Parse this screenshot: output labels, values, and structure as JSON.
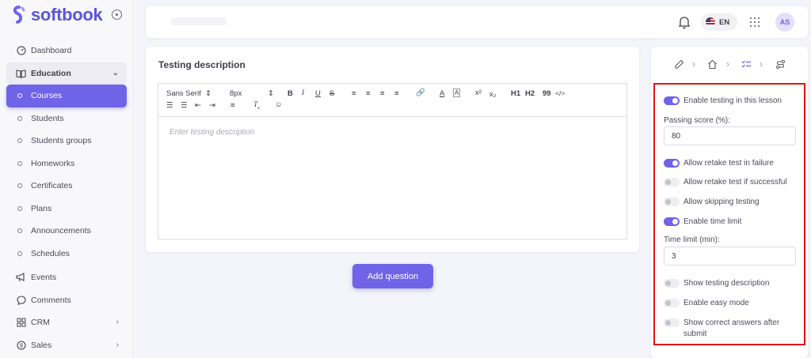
{
  "brand": {
    "name": "softbook",
    "accent": "#6f64e8"
  },
  "sidebar": {
    "items": [
      {
        "label": "Dashboard",
        "icon": "dashboard-icon"
      },
      {
        "label": "Education",
        "icon": "book-icon"
      },
      {
        "label": "Courses"
      },
      {
        "label": "Students"
      },
      {
        "label": "Students groups"
      },
      {
        "label": "Homeworks"
      },
      {
        "label": "Certificates"
      },
      {
        "label": "Plans"
      },
      {
        "label": "Announcements"
      },
      {
        "label": "Schedules"
      },
      {
        "label": "Events",
        "icon": "megaphone-icon"
      },
      {
        "label": "Comments",
        "icon": "comment-icon"
      },
      {
        "label": "CRM",
        "icon": "grid-icon"
      },
      {
        "label": "Sales",
        "icon": "dollar-icon"
      }
    ]
  },
  "header": {
    "language": "EN",
    "avatar": "AS"
  },
  "main": {
    "title": "Testing description",
    "toolbar": {
      "font": "Sans Serif",
      "size": "8px",
      "h1": "H1",
      "h2": "H2",
      "quote": "99",
      "code": "</>"
    },
    "placeholder": "Enter testing description",
    "add_question": "Add question"
  },
  "settings": {
    "enable_testing": {
      "label": "Enable testing in this lesson",
      "on": true
    },
    "passing_score_label": "Passing score (%):",
    "passing_score": "80",
    "retake_failure": {
      "label": "Allow retake test in failure",
      "on": true
    },
    "retake_success": {
      "label": "Allow retake test if successful",
      "on": false
    },
    "skip_testing": {
      "label": "Allow skipping testing",
      "on": false
    },
    "time_limit_toggle": {
      "label": "Enable time limit",
      "on": true
    },
    "time_limit_label": "Time limit (min):",
    "time_limit": "3",
    "show_description": {
      "label": "Show testing description",
      "on": false
    },
    "easy_mode": {
      "label": "Enable easy mode",
      "on": false
    },
    "show_answers": {
      "label": "Show correct answers after submit",
      "on": false
    }
  }
}
